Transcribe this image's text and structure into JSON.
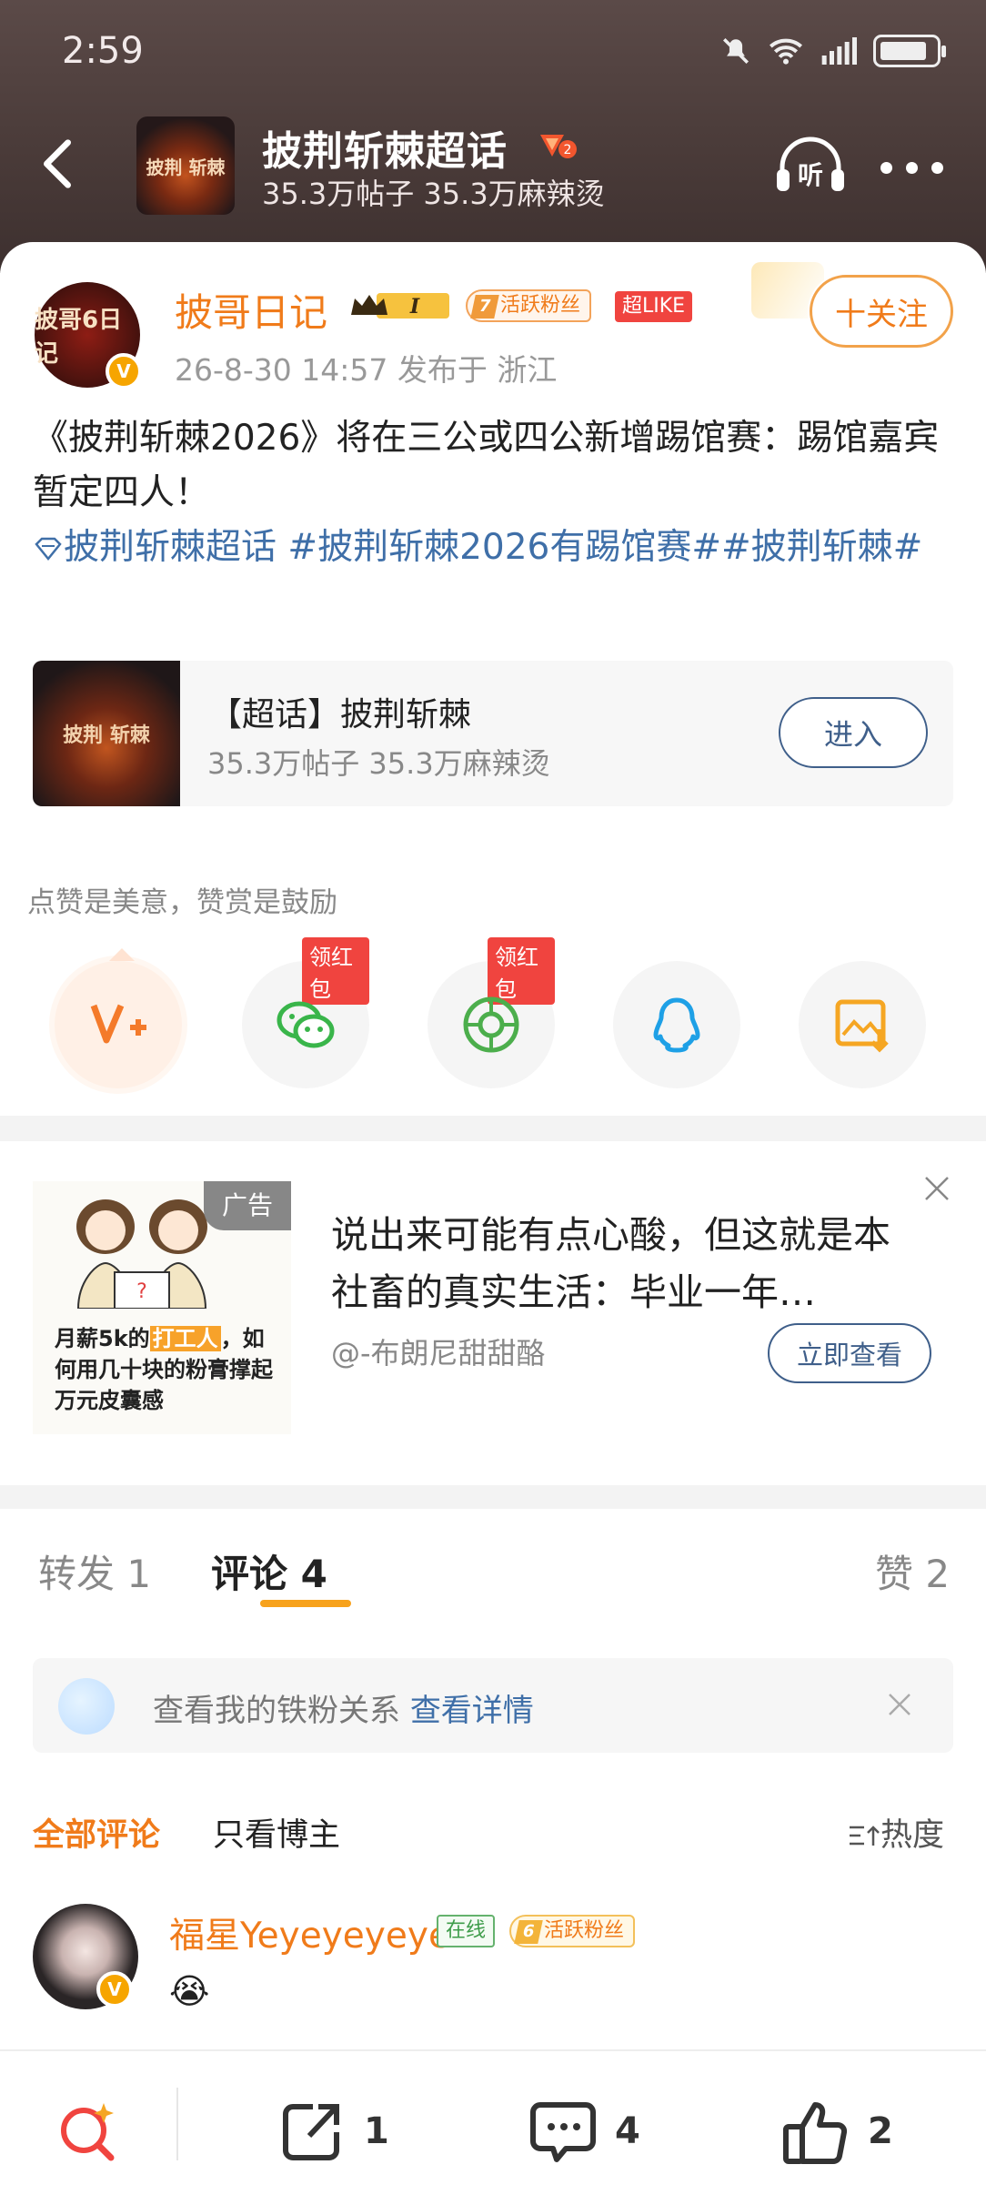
{
  "status_bar": {
    "time": "2:59"
  },
  "header": {
    "thumb_text": "披荆 斩棘",
    "title": "披荆斩棘超话",
    "badge_level": "2",
    "subtitle": "35.3万帖子 35.3万麻辣烫",
    "listen_label": "听"
  },
  "post": {
    "avatar_text": "披哥6日记",
    "author": "披哥日记",
    "crown_level": "I",
    "fan_level": "7",
    "fan_label": "活跃粉丝",
    "superlike_label": "超LIKE",
    "follow_label": "十关注",
    "meta": "26-8-30 14:57   发布于 浙江",
    "content": "《披荆斩棘2026》将在三公或四公新增踢馆赛：踢馆嘉宾暂定四人！",
    "tags": "披荆斩棘超话 #披荆斩棘2026有踢馆赛##披荆斩棘#",
    "topic_card": {
      "name": "【超话】披荆斩棘",
      "stats": "35.3万帖子 35.3万麻辣烫",
      "enter_label": "进入",
      "image_text": "披荆 斩棘"
    },
    "reward_tip": "点赞是美意，赞赏是鼓励",
    "share_items": [
      {
        "icon": "v-plus-icon"
      },
      {
        "icon": "wechat-icon",
        "tag": "领红包"
      },
      {
        "icon": "moments-icon",
        "tag": "领红包"
      },
      {
        "icon": "qq-icon"
      },
      {
        "icon": "save-image-icon"
      }
    ]
  },
  "ad": {
    "tag": "广告",
    "image_text_pre": "月薪5k的",
    "image_text_hl": "打工人",
    "image_text_post": "，如何用几十块的粉膏撑起万元皮囊感",
    "title": "说出来可能有点心酸，但这就是本社畜的真实生活：毕业一年…",
    "source": "@-布朗尼甜甜酪",
    "button": "立即查看"
  },
  "tabs": {
    "repost": "转发 1",
    "comments": "评论 4",
    "likes": "赞 2"
  },
  "iron_fans": {
    "text": "查看我的铁粉关系",
    "link": "查看详情"
  },
  "comment_filter": {
    "all": "全部评论",
    "author_only": "只看博主",
    "sort": "热度"
  },
  "comment": {
    "name": "福星Yeyeyeyeye",
    "online": "在线",
    "fan_level": "6",
    "fan_label": "活跃粉丝",
    "emoji": "😭"
  },
  "bottom_bar": {
    "repost_count": "1",
    "comment_count": "4",
    "like_count": "2"
  },
  "colors": {
    "accent": "#f07b1a",
    "link": "#3f6fa8",
    "red_tag": "#f0443f",
    "tab_underline": "#f7a21c"
  }
}
